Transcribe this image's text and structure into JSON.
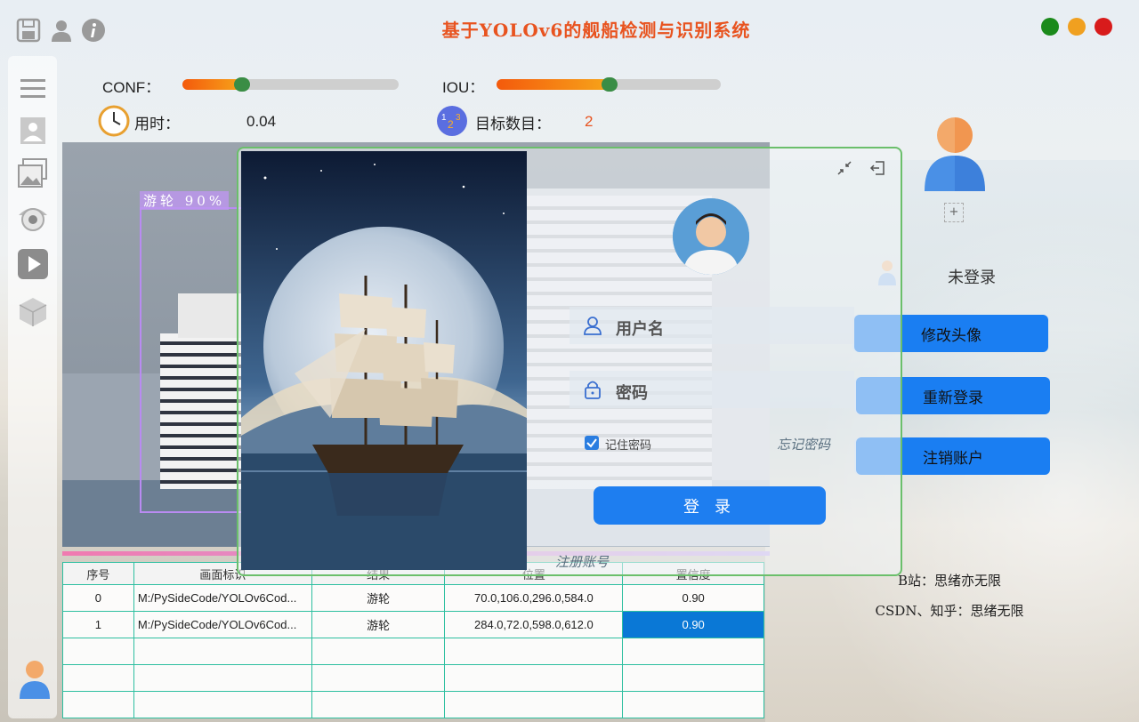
{
  "app": {
    "title": "基于YOLOv6的舰船检测与识别系统"
  },
  "toolbar": {
    "save_icon": "save-icon",
    "user_icon": "user-icon",
    "info_icon": "info-icon"
  },
  "window_controls": {
    "colors": [
      "#1b8a1b",
      "#f0a020",
      "#d81b1b"
    ]
  },
  "params": {
    "conf_label": "CONF：",
    "conf_value": 0.25,
    "iou_label": "IOU：",
    "iou_value": 0.5,
    "time_label": "用时：",
    "time_value": "0.04",
    "count_label": "目标数目：",
    "count_value": "2"
  },
  "detection": {
    "box_label": "游轮 90%"
  },
  "table": {
    "headers": [
      "序号",
      "画面标识",
      "结果",
      "位置",
      "置信度"
    ],
    "rows": [
      [
        "0",
        "M:/PySideCode/YOLOv6Cod...",
        "游轮",
        "70.0,106.0,296.0,584.0",
        "0.90"
      ],
      [
        "1",
        "M:/PySideCode/YOLOv6Cod...",
        "游轮",
        "284.0,72.0,598.0,612.0",
        "0.90"
      ]
    ]
  },
  "login": {
    "username_placeholder": "用户名",
    "password_placeholder": "密码",
    "remember_label": "记住密码",
    "remember_checked": true,
    "forgot_label": "忘记密码",
    "login_button": "登 录",
    "register_link": "注册账号"
  },
  "account": {
    "add_icon": "+",
    "status": "未登录",
    "change_avatar": "修改头像",
    "relogin": "重新登录",
    "delete_account": "注销账户",
    "footer_1": "B站：思绪亦无限",
    "footer_2": "CSDN、知乎：思绪无限"
  },
  "colors": {
    "accent": "#1e7ef0",
    "title": "#e8531f",
    "table_border": "#2dbfa0"
  }
}
